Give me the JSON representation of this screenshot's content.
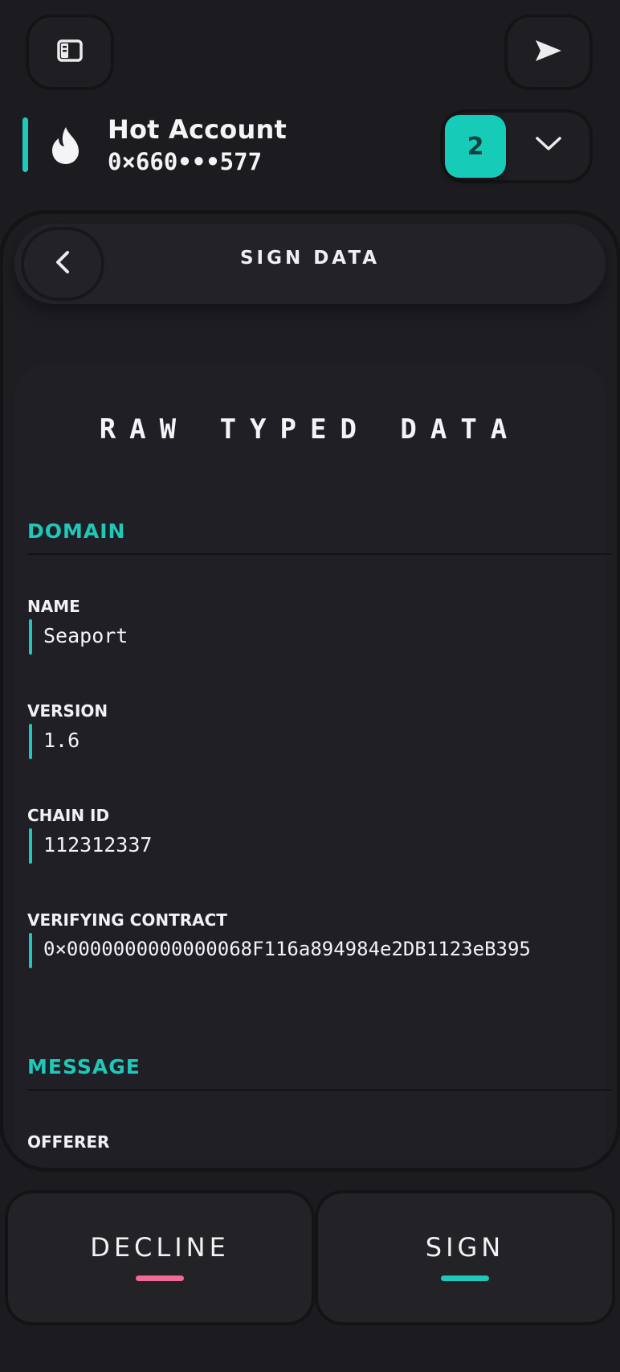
{
  "top_bar": {
    "left_icon": "sidebar-icon",
    "right_icon": "send-icon"
  },
  "account": {
    "icon": "flame-icon",
    "name": "Hot Account",
    "address": "0×660•••577",
    "count": "2",
    "accent_color": "#1fc8b8"
  },
  "header": {
    "title": "SIGN DATA",
    "back_icon": "chevron-left-icon"
  },
  "content": {
    "title": "RAW TYPED DATA",
    "domain": {
      "heading": "DOMAIN",
      "fields": [
        {
          "label": "NAME",
          "value": "Seaport"
        },
        {
          "label": "VERSION",
          "value": "1.6"
        },
        {
          "label": "CHAIN ID",
          "value": "112312337"
        },
        {
          "label": "VERIFYING CONTRACT",
          "value": "0×0000000000000068F116a894984e2DB1123eB395"
        }
      ]
    },
    "message": {
      "heading": "MESSAGE",
      "fields": [
        {
          "label": "OFFERER"
        }
      ]
    }
  },
  "actions": {
    "decline_label": "DECLINE",
    "decline_color": "#f06b95",
    "sign_label": "SIGN",
    "sign_color": "#1fc8b8"
  }
}
